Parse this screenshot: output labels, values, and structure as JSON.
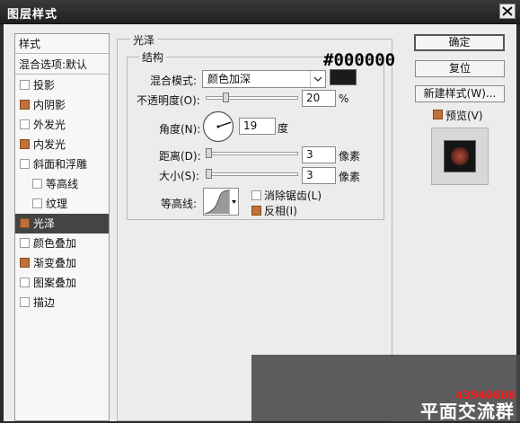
{
  "window": {
    "title": "图层样式"
  },
  "styles_panel": {
    "header": "样式",
    "blend_options": "混合选项:默认",
    "items": [
      {
        "label": "投影",
        "checked": false,
        "sub": false,
        "selected": false
      },
      {
        "label": "内阴影",
        "checked": true,
        "sub": false,
        "selected": false
      },
      {
        "label": "外发光",
        "checked": false,
        "sub": false,
        "selected": false
      },
      {
        "label": "内发光",
        "checked": true,
        "sub": false,
        "selected": false
      },
      {
        "label": "斜面和浮雕",
        "checked": false,
        "sub": false,
        "selected": false
      },
      {
        "label": "等高线",
        "checked": false,
        "sub": true,
        "selected": false
      },
      {
        "label": "纹理",
        "checked": false,
        "sub": true,
        "selected": false
      },
      {
        "label": "光泽",
        "checked": true,
        "sub": false,
        "selected": true
      },
      {
        "label": "颜色叠加",
        "checked": false,
        "sub": false,
        "selected": false
      },
      {
        "label": "渐变叠加",
        "checked": true,
        "sub": false,
        "selected": false
      },
      {
        "label": "图案叠加",
        "checked": false,
        "sub": false,
        "selected": false
      },
      {
        "label": "描边",
        "checked": false,
        "sub": false,
        "selected": false
      }
    ]
  },
  "satin": {
    "group_title": "光泽",
    "structure_title": "结构",
    "blend_mode_label": "混合模式:",
    "blend_mode_value": "颜色加深",
    "color_hex_annotation": "#000000",
    "color": "#1b1b1b",
    "opacity_label": "不透明度(O):",
    "opacity_value": "20",
    "opacity_unit": "%",
    "angle_label": "角度(N):",
    "angle_value": "19",
    "angle_unit": "度",
    "distance_label": "距离(D):",
    "distance_value": "3",
    "distance_unit": "像素",
    "size_label": "大小(S):",
    "size_value": "3",
    "size_unit": "像素",
    "contour_label": "等高线:",
    "antialias_label": "消除锯齿(L)",
    "antialias_checked": false,
    "invert_label": "反相(I)",
    "invert_checked": true
  },
  "buttons": {
    "ok": "确定",
    "reset": "复位",
    "new_style": "新建样式(W)...",
    "preview_label": "预览(V)",
    "preview_checked": true
  },
  "watermark": {
    "number": "43940608",
    "text": "平面交流群"
  },
  "colors": {
    "checked": "#c0703a",
    "selected_bg": "#444444",
    "watermark_number": "#ff1a1a"
  }
}
